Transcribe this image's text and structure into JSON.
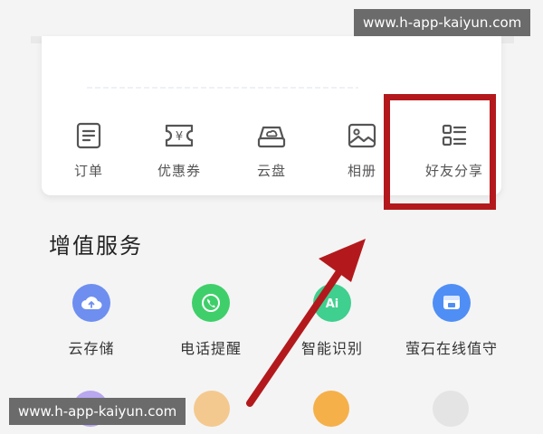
{
  "tools": [
    {
      "label": "订单",
      "icon": "order-icon"
    },
    {
      "label": "优惠券",
      "icon": "coupon-icon"
    },
    {
      "label": "云盘",
      "icon": "cloud-disk-icon"
    },
    {
      "label": "相册",
      "icon": "album-icon"
    },
    {
      "label": "好友分享",
      "icon": "friend-share-icon"
    }
  ],
  "section": {
    "title": "增值服务"
  },
  "services": [
    {
      "label": "云存储",
      "icon": "cloud-storage-icon",
      "color": "#6e8ff0"
    },
    {
      "label": "电话提醒",
      "icon": "phone-reminder-icon",
      "color": "#3fcf6a"
    },
    {
      "label": "智能识别",
      "icon": "ai-recognition-icon",
      "color": "#3fcf8e"
    },
    {
      "label": "萤石在线值守",
      "icon": "online-guard-icon",
      "color": "#4f8ef5"
    }
  ],
  "colors": {
    "highlight": "#b3191c",
    "arrow": "#b3191c",
    "icon_stroke": "#555555"
  },
  "watermark": {
    "text": "www.h-app-kaiyun.com"
  }
}
